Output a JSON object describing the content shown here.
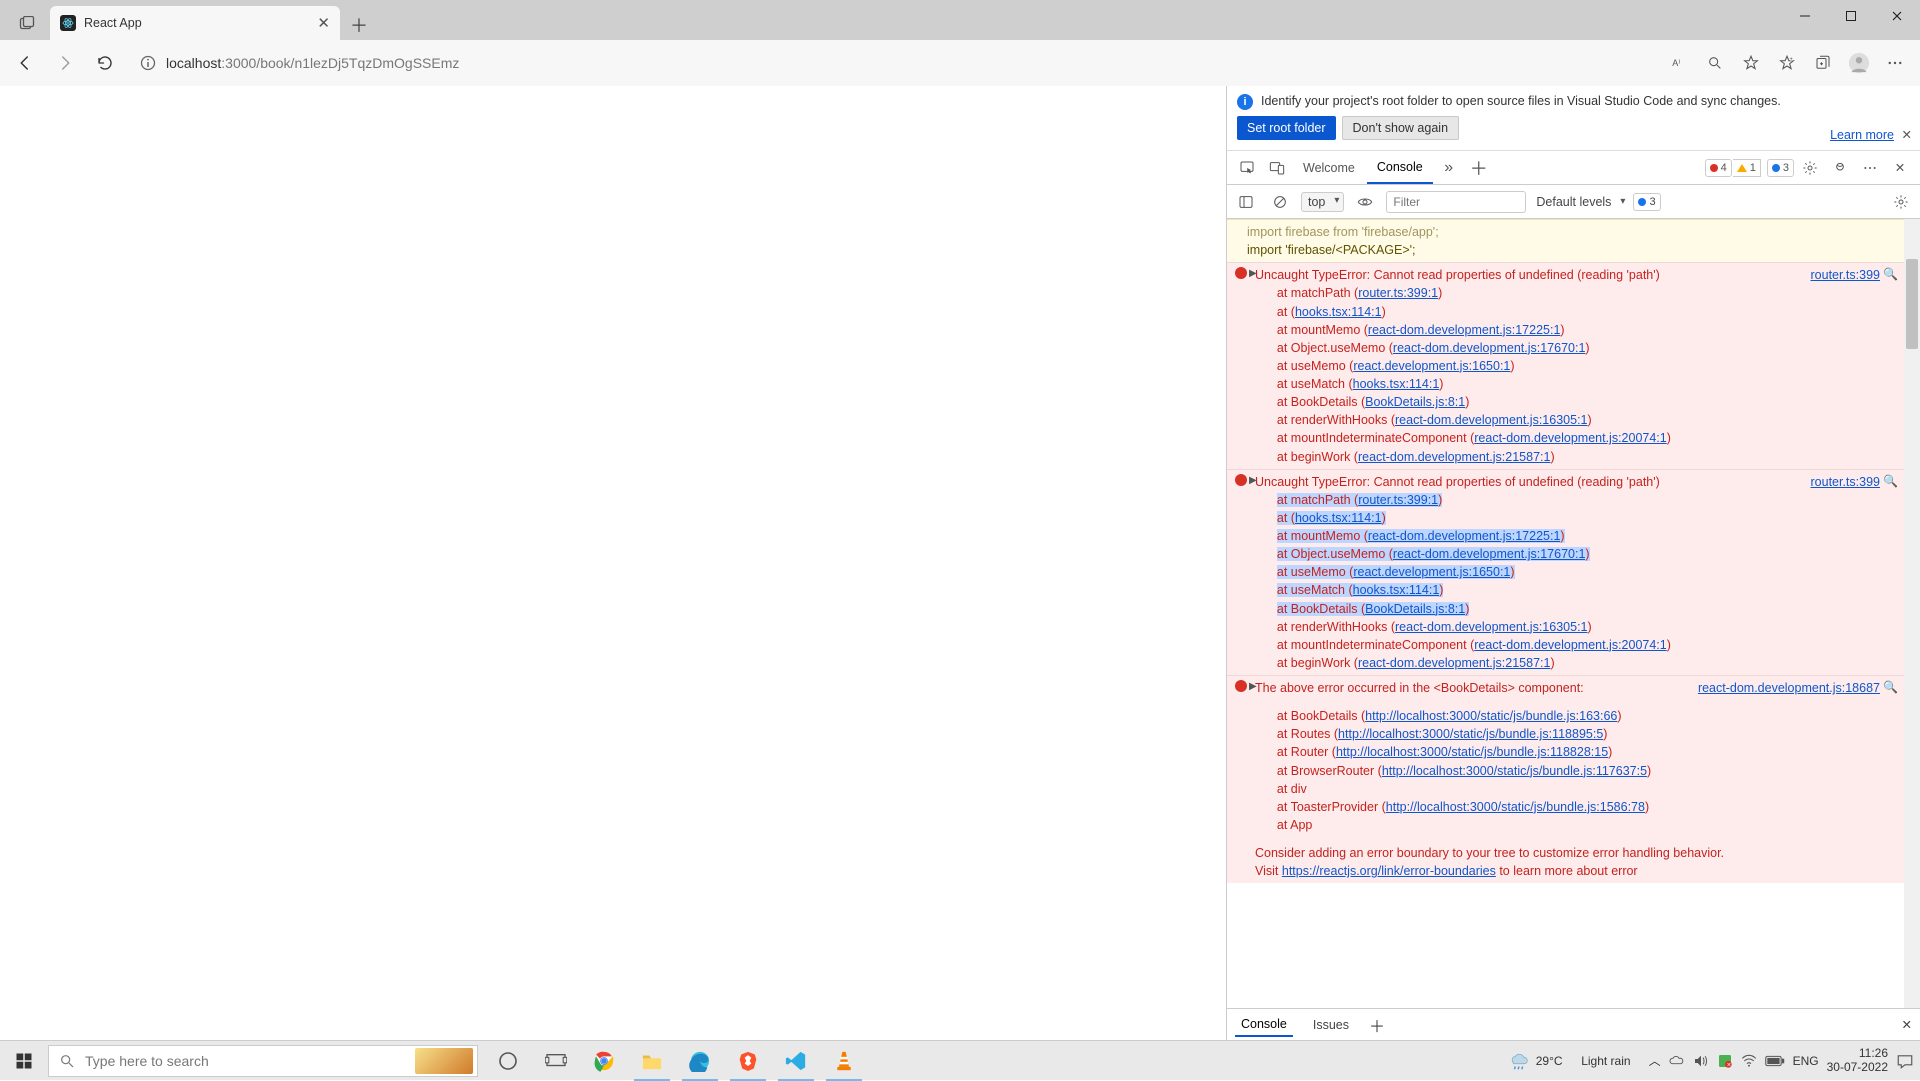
{
  "browser": {
    "tab_title": "React App",
    "url_host": "localhost",
    "url_port_path": ":3000/book/n1lezDj5TqzDmOgSSEmz"
  },
  "devtools": {
    "notice_text": "Identify your project's root folder to open source files in Visual Studio Code and sync changes.",
    "learn_more": "Learn more",
    "btn_set_root": "Set root folder",
    "btn_dont_show": "Don't show again",
    "tab_welcome": "Welcome",
    "tab_console": "Console",
    "counts": {
      "errors": "4",
      "warnings": "1",
      "info": "3"
    },
    "ctx_label": "top",
    "filter_placeholder": "Filter",
    "levels_label": "Default levels",
    "issues_badge": "3",
    "warn_banner_prefix": "import 'firebase/<PACKAGE>';",
    "warn_banner_top": "import firebase from 'firebase/app';",
    "error_head": "Uncaught TypeError: Cannot read properties of undefined (reading 'path')",
    "error_src": "router.ts:399",
    "stack": [
      {
        "fn": "matchPath",
        "loc": "router.ts:399:1"
      },
      {
        "fn": "",
        "loc": "hooks.tsx:114:1"
      },
      {
        "fn": "mountMemo",
        "loc": "react-dom.development.js:17225:1"
      },
      {
        "fn": "Object.useMemo",
        "loc": "react-dom.development.js:17670:1"
      },
      {
        "fn": "useMemo",
        "loc": "react.development.js:1650:1"
      },
      {
        "fn": "useMatch",
        "loc": "hooks.tsx:114:1"
      },
      {
        "fn": "BookDetails",
        "loc": "BookDetails.js:8:1"
      },
      {
        "fn": "renderWithHooks",
        "loc": "react-dom.development.js:16305:1"
      },
      {
        "fn": "mountIndeterminateComponent",
        "loc": "react-dom.development.js:20074:1"
      },
      {
        "fn": "beginWork",
        "loc": "react-dom.development.js:21587:1"
      }
    ],
    "hl_indices": [
      0,
      1,
      2,
      3,
      4,
      5,
      6
    ],
    "err3_head": "The above error occurred in the <BookDetails> component:",
    "err3_src": "react-dom.development.js:18687",
    "err3_stack": [
      {
        "fn": "BookDetails",
        "loc": "http://localhost:3000/static/js/bundle.js:163:66"
      },
      {
        "fn": "Routes",
        "loc": "http://localhost:3000/static/js/bundle.js:118895:5"
      },
      {
        "fn": "Router",
        "loc": "http://localhost:3000/static/js/bundle.js:118828:15"
      },
      {
        "fn": "BrowserRouter",
        "loc": "http://localhost:3000/static/js/bundle.js:117637:5"
      },
      {
        "fn": "div",
        "loc": ""
      },
      {
        "fn": "ToasterProvider",
        "loc": "http://localhost:3000/static/js/bundle.js:1586:78"
      },
      {
        "fn": "App",
        "loc": ""
      }
    ],
    "err3_tail1": "Consider adding an error boundary to your tree to customize error handling behavior.",
    "err3_tail2_prefix": "Visit ",
    "err3_tail2_link": "https://reactjs.org/link/error-boundaries",
    "err3_tail2_suffix": " to learn more about error",
    "bottom_tab_console": "Console",
    "bottom_tab_issues": "Issues"
  },
  "taskbar": {
    "search_placeholder": "Type here to search",
    "weather_temp": "29°C",
    "weather_desc": "Light rain",
    "lang": "ENG",
    "time": "11:26",
    "date": "30-07-2022"
  }
}
